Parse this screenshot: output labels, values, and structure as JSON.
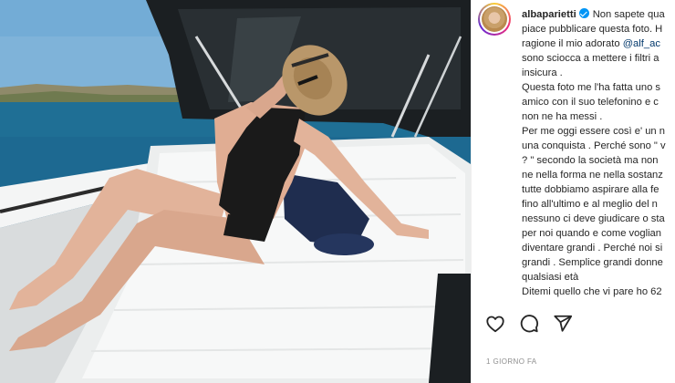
{
  "post": {
    "username": "albaparietti",
    "caption_lines": [
      "Non sapete qua",
      "piace pubblicare questa foto. H",
      "ragione il mio adorato",
      "sono sciocca a mettere i filtri a",
      "insicura .",
      "Questa foto me l'ha fatta uno s",
      "amico con il suo telefonino e c",
      "non ne ha messi .",
      "Per me oggi essere così e' un n",
      "una conquista . Perché sono \" v",
      "? \" secondo la società ma non",
      "ne nella forma ne nella sostanz",
      "tutte dobbiamo aspirare alla fe",
      "fino all'ultimo e al meglio del n",
      "nessuno ci deve giudicare o sta",
      "per noi quando e come voglian",
      "diventare grandi . Perché noi si",
      "grandi . Semplice grandi donne",
      "qualsiasi età",
      "Ditemi quello che vi pare ho 62"
    ],
    "mention": "@alf_ac",
    "timestamp": "1 GIORNO FA"
  },
  "icons": {
    "verified": "verified-badge-icon",
    "like": "heart-icon",
    "comment": "comment-bubble-icon",
    "share": "paper-plane-icon"
  },
  "colors": {
    "sea": "#2a6e95",
    "towel": "#f3f4f4",
    "swimsuit": "#1a1a1a",
    "verified": "#0095f6",
    "mention": "#00376b",
    "muted": "#8e8e8e"
  }
}
